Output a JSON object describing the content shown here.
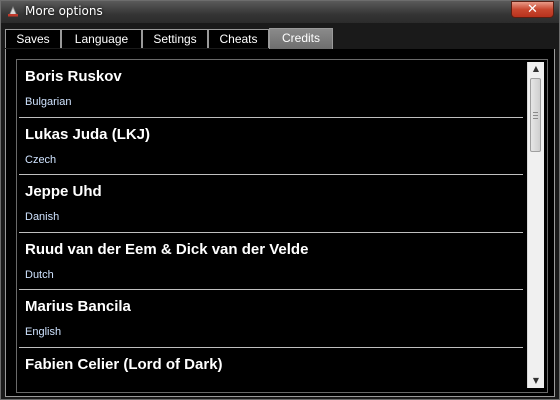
{
  "window": {
    "title": "More options",
    "close_label": "✕"
  },
  "tabs": [
    {
      "label": "Saves"
    },
    {
      "label": "Language"
    },
    {
      "label": "Settings"
    },
    {
      "label": "Cheats"
    },
    {
      "label": "Credits"
    }
  ],
  "active_tab": "Credits",
  "credits": [
    {
      "name": "Boris Ruskov",
      "language": "Bulgarian"
    },
    {
      "name": "Lukas Juda (LKJ)",
      "language": "Czech"
    },
    {
      "name": "Jeppe Uhd",
      "language": "Danish"
    },
    {
      "name": "Ruud van der Eem & Dick van der Velde",
      "language": "Dutch"
    },
    {
      "name": "Marius Bancila",
      "language": "English"
    },
    {
      "name": "Fabien Celier (Lord of Dark)",
      "language": ""
    }
  ],
  "scrollbar": {
    "up_glyph": "▲",
    "down_glyph": "▼"
  }
}
